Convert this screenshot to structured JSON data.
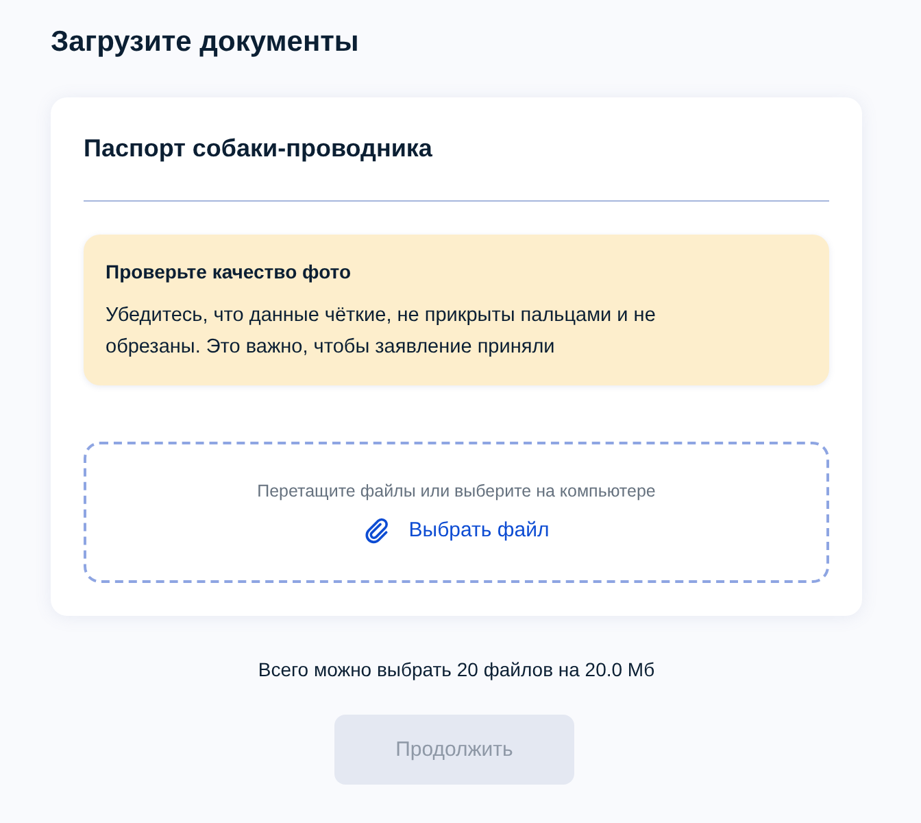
{
  "title": "Загрузите документы",
  "card": {
    "title": "Паспорт собаки-проводника",
    "alert": {
      "title": "Проверьте качество фото",
      "text": "Убедитесь, что данные чёткие, не прикрыты пальцами и не обрезаны. Это важно, чтобы заявление приняли"
    },
    "dropzone": {
      "hint": "Перетащите файлы или выберите на компьютере",
      "link": "Выбрать файл"
    }
  },
  "limit_text": "Всего можно выбрать 20 файлов на 20.0 Мб",
  "continue_button": {
    "label": "Продолжить",
    "disabled": true
  }
}
